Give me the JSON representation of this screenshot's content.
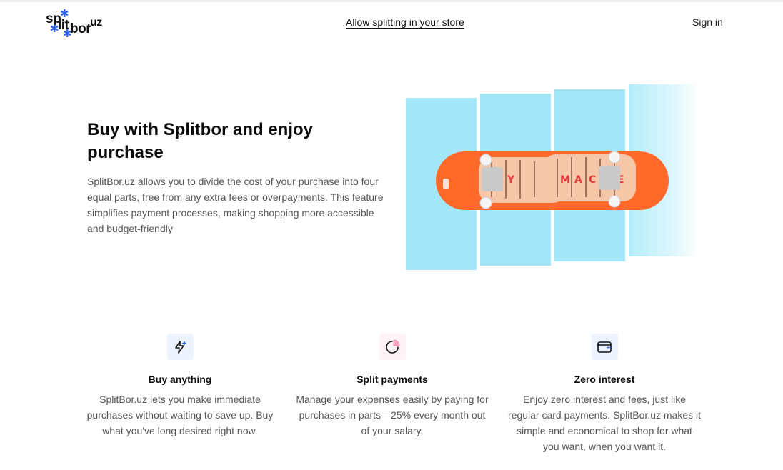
{
  "header": {
    "logo_text": "splitbor.uz",
    "center_link": "Allow splitting in your store",
    "signin_label": "Sign in"
  },
  "hero": {
    "title": "Buy with Splitbor and enjoy purchase",
    "description": "SplitBor.uz allows you to divide the cost of your purchase into four equal parts, free from any extra fees or overpayments. This feature simplifies payment processes, making shopping more accessible and budget-friendly",
    "image_alt": "skateboard split into four parts"
  },
  "features": [
    {
      "icon": "sparkle-bolt-icon",
      "title": "Buy anything",
      "text": "SplitBor.uz lets you make immediate purchases without waiting to save up. Buy what you've long desired right now."
    },
    {
      "icon": "pie-segment-icon",
      "title": "Split payments",
      "text": "Manage your expenses easily by paying for purchases in parts—25% every month out of your salary."
    },
    {
      "icon": "wallet-icon",
      "title": "Zero interest",
      "text": "Enjoy zero interest and fees, just like regular card payments. SplitBor.uz makes it simple and economical to shop for what you want, when you want it."
    }
  ],
  "colors": {
    "panel_blue": "#a3e6f8",
    "accent_blue": "#2f63e8",
    "deck_orange": "#ff6a2a",
    "icon_pink": "#f07aa0"
  }
}
